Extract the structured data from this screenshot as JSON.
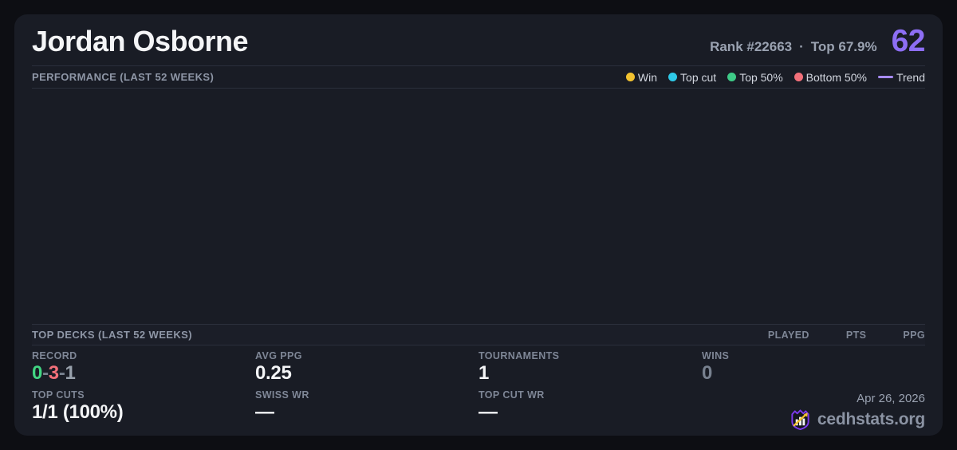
{
  "header": {
    "title": "Jordan Osborne",
    "rank": "Rank #22663",
    "separator": "·",
    "top_percent": "Top 67.9%",
    "score": "62",
    "score_color": "#8d6ef4"
  },
  "performance": {
    "title": "PERFORMANCE (LAST 52 WEEKS)",
    "legend": {
      "items": [
        {
          "label": "Win",
          "color": "#f2c230",
          "type": "dot"
        },
        {
          "label": "Top cut",
          "color": "#2ec9e8",
          "type": "dot"
        },
        {
          "label": "Top 50%",
          "color": "#3ecb87",
          "type": "dot"
        },
        {
          "label": "Bottom 50%",
          "color": "#f2707a",
          "type": "dot"
        },
        {
          "label": "Trend",
          "color": "#a78bfa",
          "type": "line"
        }
      ]
    },
    "chart_empty": true
  },
  "top_decks": {
    "title": "TOP DECKS (LAST 52 WEEKS)",
    "columns": [
      "PLAYED",
      "PTS",
      "PPG"
    ]
  },
  "stats": {
    "record": {
      "label": "RECORD",
      "wins": "0",
      "losses": "3",
      "draws": "1",
      "separator": "-",
      "colors": {
        "wins": "#42d683",
        "losses": "#f2707a",
        "draws": "#98a1ac"
      }
    },
    "top_cuts": {
      "label": "TOP CUTS",
      "value": "1/1 (100%)"
    },
    "avg_ppg": {
      "label": "AVG PPG",
      "value": "0.25"
    },
    "swiss_wr": {
      "label": "SWISS WR",
      "value": "—"
    },
    "tournaments": {
      "label": "TOURNAMENTS",
      "value": "1"
    },
    "top_cut_wr": {
      "label": "TOP CUT WR",
      "value": "—"
    },
    "wins": {
      "label": "WINS",
      "value": "0"
    }
  },
  "footer": {
    "date": "Apr 26, 2026",
    "brand": "cedhstats.org"
  }
}
